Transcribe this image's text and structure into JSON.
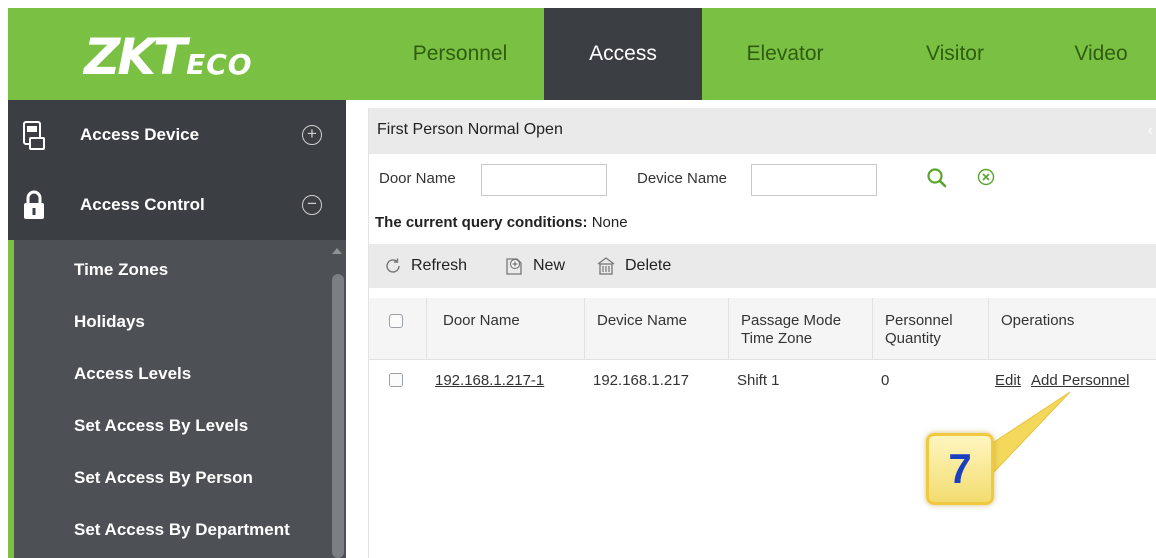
{
  "app": {
    "logo_main": "ZKT",
    "logo_tail": "ECO"
  },
  "nav": {
    "tabs": [
      {
        "label": "Personnel",
        "active": false
      },
      {
        "label": "Access",
        "active": true
      },
      {
        "label": "Elevator",
        "active": false
      },
      {
        "label": "Visitor",
        "active": false
      },
      {
        "label": "Video",
        "active": false
      }
    ]
  },
  "sidebar": {
    "groups": [
      {
        "label": "Access Device",
        "icon": "device-icon",
        "toggle": "+"
      },
      {
        "label": "Access Control",
        "icon": "lock-icon",
        "toggle": "−"
      }
    ],
    "items": [
      {
        "label": "Time Zones"
      },
      {
        "label": "Holidays"
      },
      {
        "label": "Access Levels"
      },
      {
        "label": "Set Access By Levels"
      },
      {
        "label": "Set Access By Person"
      },
      {
        "label": "Set Access By Department"
      }
    ]
  },
  "panel": {
    "title": "First Person Normal Open",
    "collapse_glyph": "‹"
  },
  "search": {
    "door_name_label": "Door Name",
    "door_name_value": "",
    "device_name_label": "Device Name",
    "device_name_value": ""
  },
  "query": {
    "label": "The current query conditions:",
    "value": "None"
  },
  "toolbar": {
    "refresh_label": "Refresh",
    "new_label": "New",
    "delete_label": "Delete"
  },
  "table": {
    "columns": [
      {
        "label": "Door Name"
      },
      {
        "label": "Device Name"
      },
      {
        "label": "Passage Mode\nTime Zone"
      },
      {
        "label": "Personnel\nQuantity"
      },
      {
        "label": "Operations"
      }
    ],
    "rows": [
      {
        "door_name": "192.168.1.217-1",
        "device_name": "192.168.1.217",
        "passage_mode": "Shift 1",
        "personnel_quantity": "0",
        "op_edit": "Edit",
        "op_add": "Add Personnel"
      }
    ]
  },
  "callout": {
    "number": "7"
  },
  "colors": {
    "brand_green": "#7ac143",
    "dark_nav": "#3b3e43",
    "callout_number": "#1a3fbf"
  }
}
